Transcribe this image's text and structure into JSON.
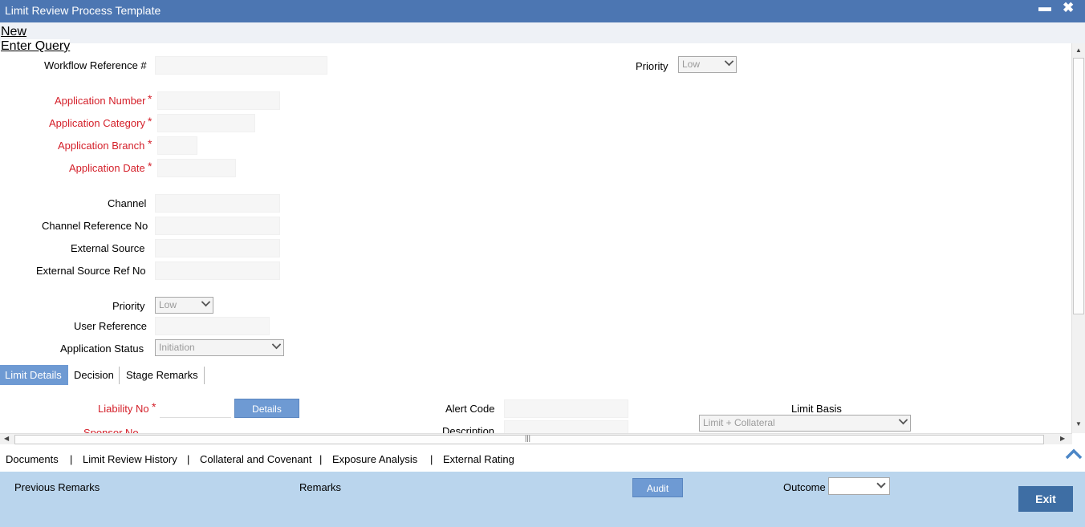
{
  "window": {
    "title": "Limit Review Process Template",
    "minimize_label": "▃",
    "close_label": "✖"
  },
  "menu": {
    "new_label": "New",
    "enter_query_label": "Enter Query"
  },
  "form": {
    "workflow_ref_label": "Workflow Reference #",
    "workflow_ref_value": "",
    "priority_top_label": "Priority",
    "priority_top_value": "Low",
    "application_number_label": "Application Number",
    "application_category_label": "Application Category",
    "application_branch_label": "Application Branch",
    "application_date_label": "Application Date",
    "channel_label": "Channel",
    "channel_ref_label": "Channel Reference No",
    "external_source_label": "External Source",
    "external_source_ref_label": "External Source Ref No",
    "priority_label": "Priority",
    "priority_value": "Low",
    "user_reference_label": "User Reference",
    "application_status_label": "Application Status",
    "application_status_value": "Initiation",
    "required_mark": "*"
  },
  "tabs": [
    {
      "label": "Limit Details",
      "active": true
    },
    {
      "label": "Decision",
      "active": false
    },
    {
      "label": "Stage Remarks",
      "active": false
    }
  ],
  "limit_details": {
    "liability_no_label": "Liability No",
    "details_button": "Details",
    "alert_code_label": "Alert Code",
    "description_label": "Description",
    "limit_basis_label": "Limit Basis",
    "limit_basis_value": "Limit + Collateral",
    "partial_label": "Sponsor No"
  },
  "bottom_links": [
    "Documents",
    "Limit Review History",
    "Collateral and Covenant",
    "Exposure Analysis",
    "External Rating"
  ],
  "link_separator": "|",
  "footer": {
    "previous_remarks_label": "Previous Remarks",
    "remarks_label": "Remarks",
    "audit_button": "Audit",
    "outcome_label": "Outcome",
    "outcome_value": "",
    "exit_button": "Exit"
  },
  "colors": {
    "title_bar": "#4c76b2",
    "required_label": "#d4202a",
    "active_tab": "#6e9ad3",
    "footer_bg": "#bad5ed",
    "exit_button": "#3e6ea4"
  }
}
